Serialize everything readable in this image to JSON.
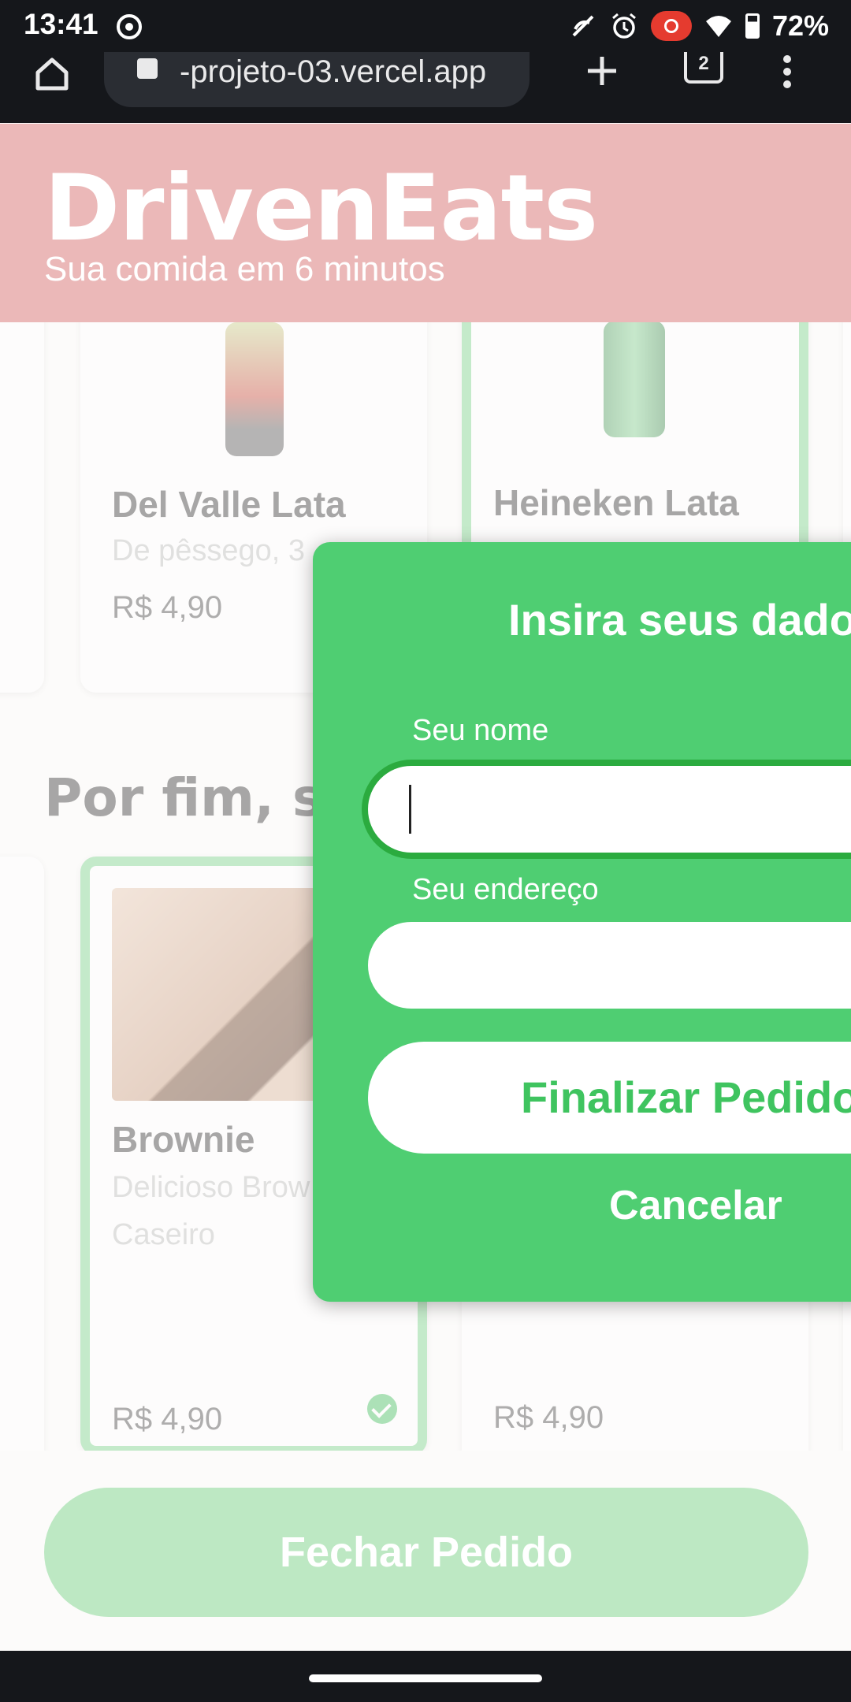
{
  "status_bar": {
    "time": "13:41",
    "battery_percent": "72%",
    "battery_level": 0.72,
    "icons": [
      "screen-record-icon",
      "call-muted-icon",
      "alarm-icon",
      "recording-indicator-icon",
      "wifi-icon",
      "battery-icon"
    ]
  },
  "browser": {
    "url": "-projeto-03.vercel.app",
    "tab_count": "2"
  },
  "app": {
    "title": "DrivenEats",
    "tagline": "Sua comida em 6 minutos",
    "colors": {
      "header": "#ebb8b8",
      "accent": "#4fce72",
      "selected_border": "#79d48a"
    }
  },
  "drinks": [
    {
      "name": "Del Valle Lata",
      "description": "De pêssego, 3",
      "price": "R$ 4,90"
    },
    {
      "name": "Heineken Lata",
      "description": "",
      "price": ""
    }
  ],
  "dessert_section": {
    "title": "Por fim, su",
    "items": [
      {
        "name": "Brownie",
        "description_line1": "Delicioso Brow",
        "description_line2": "Caseiro",
        "price": "R$ 4,90",
        "selected": true
      },
      {
        "name": "",
        "description_line1": "",
        "description_line2": "",
        "price": "R$ 4,90",
        "selected": false
      }
    ]
  },
  "checkout_button": {
    "label": "Fechar Pedido"
  },
  "modal": {
    "title": "Insira seus dado",
    "name_label": "Seu nome",
    "name_value": "",
    "address_label": "Seu endereço",
    "address_value": "",
    "submit_label": "Finalizar Pedido",
    "cancel_label": "Cancelar"
  }
}
